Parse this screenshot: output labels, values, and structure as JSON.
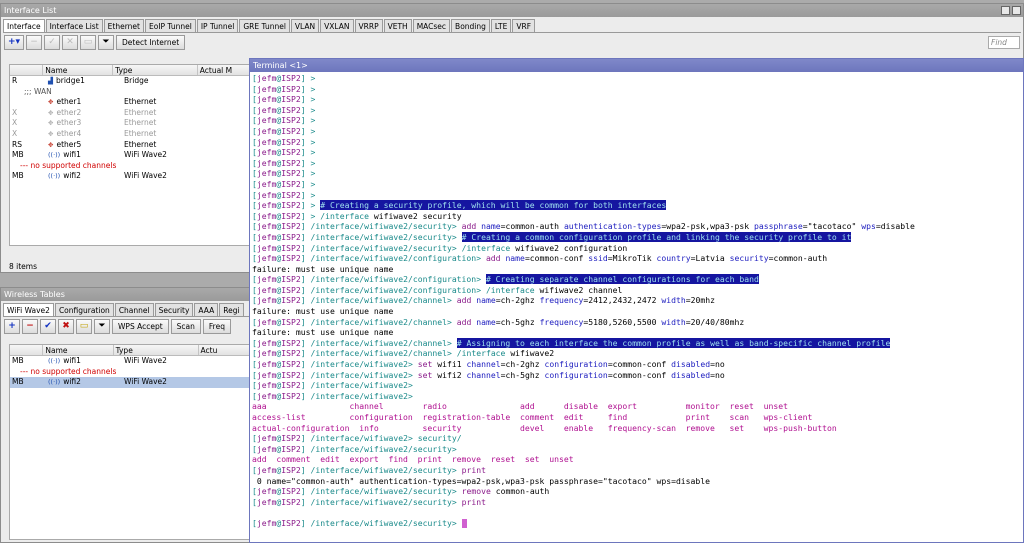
{
  "interface_window": {
    "title": "Interface List",
    "tabs": [
      "Interface",
      "Interface List",
      "Ethernet",
      "EoIP Tunnel",
      "IP Tunnel",
      "GRE Tunnel",
      "VLAN",
      "VXLAN",
      "VRRP",
      "VETH",
      "MACsec",
      "Bonding",
      "LTE",
      "VRF"
    ],
    "detect_button": "Detect Internet",
    "find_placeholder": "Find",
    "columns": [
      "",
      "Name",
      "Type",
      "Actual M"
    ],
    "rows": [
      {
        "flag": "R",
        "name": "bridge1",
        "type": "Bridge",
        "icon": "bridge-icon"
      },
      {
        "section": ";;; WAN"
      },
      {
        "flag": "",
        "name": "ether1",
        "type": "Ethernet",
        "icon": "ethernet-icon"
      },
      {
        "flag": "X",
        "name": "ether2",
        "type": "Ethernet",
        "icon": "ethernet-icon",
        "disabled": true
      },
      {
        "flag": "X",
        "name": "ether3",
        "type": "Ethernet",
        "icon": "ethernet-icon",
        "disabled": true
      },
      {
        "flag": "X",
        "name": "ether4",
        "type": "Ethernet",
        "icon": "ethernet-icon",
        "disabled": true
      },
      {
        "flag": "RS",
        "name": "ether5",
        "type": "Ethernet",
        "icon": "ethernet-icon"
      },
      {
        "flag": "MB",
        "name": "wifi1",
        "type": "WiFi Wave2",
        "icon": "wifi-icon"
      },
      {
        "comment": "--- no supported channels"
      },
      {
        "flag": "MB",
        "name": "wifi2",
        "type": "WiFi Wave2",
        "icon": "wifi-icon"
      }
    ],
    "status": "8 items"
  },
  "wireless_window": {
    "title": "Wireless Tables",
    "tabs": [
      "WiFi Wave2",
      "Configuration",
      "Channel",
      "Security",
      "AAA",
      "Regi"
    ],
    "wps_button": "WPS Accept",
    "scan_button": "Scan",
    "freq_button": "Freq",
    "columns": [
      "",
      "Name",
      "Type",
      "Actu"
    ],
    "rows": [
      {
        "flag": "MB",
        "name": "wifi1",
        "type": "WiFi Wave2"
      },
      {
        "comment": "--- no supported channels"
      },
      {
        "flag": "MB",
        "name": "wifi2",
        "type": "WiFi Wave2",
        "selected": true
      }
    ]
  },
  "terminal": {
    "title": "Terminal <1>",
    "user": "jefm",
    "host": "ISP2",
    "lines": [
      {
        "path": "",
        "cmd": ""
      },
      {
        "path": "",
        "cmd": ""
      },
      {
        "path": "",
        "cmd": ""
      },
      {
        "path": "",
        "cmd": ""
      },
      {
        "path": "",
        "cmd": ""
      },
      {
        "path": "",
        "cmd": ""
      },
      {
        "path": "",
        "cmd": ""
      },
      {
        "path": "",
        "cmd": ""
      },
      {
        "path": "",
        "cmd": ""
      },
      {
        "path": "",
        "cmd": ""
      },
      {
        "path": "",
        "cmd": ""
      },
      {
        "path": "",
        "cmd": ""
      },
      {
        "path": "",
        "comment": "# Creating a security profile, which will be common for both interfaces"
      },
      {
        "path": "",
        "cmd": "/interface wifiwave2 security"
      },
      {
        "path": "/interface/wifiwave2/security",
        "cmd": "add name=common-auth authentication-types=wpa2-psk,wpa3-psk passphrase=\"tacotaco\" wps=disable"
      },
      {
        "path": "/interface/wifiwave2/security",
        "comment": "# Creating a common configuration profile and linking the security profile to it"
      },
      {
        "path": "/interface/wifiwave2/security",
        "cmd": "/interface wifiwave2 configuration"
      },
      {
        "path": "/interface/wifiwave2/configuration",
        "cmd": "add name=common-conf ssid=MikroTik country=Latvia security=common-auth"
      },
      {
        "output": "failure: must use unique name"
      },
      {
        "path": "/interface/wifiwave2/configuration",
        "comment": "# Creating separate channel configurations for each band"
      },
      {
        "path": "/interface/wifiwave2/configuration",
        "cmd": "/interface wifiwave2 channel"
      },
      {
        "path": "/interface/wifiwave2/channel",
        "cmd": "add name=ch-2ghz frequency=2412,2432,2472 width=20mhz"
      },
      {
        "output": "failure: must use unique name"
      },
      {
        "path": "/interface/wifiwave2/channel",
        "cmd": "add name=ch-5ghz frequency=5180,5260,5500 width=20/40/80mhz"
      },
      {
        "output": "failure: must use unique name"
      },
      {
        "path": "/interface/wifiwave2/channel",
        "comment": "# Assigning to each interface the common profile as well as band-specific channel profile"
      },
      {
        "path": "/interface/wifiwave2/channel",
        "cmd": "/interface wifiwave2"
      },
      {
        "path": "/interface/wifiwave2",
        "cmd": "set wifi1 channel=ch-2ghz configuration=common-conf disabled=no"
      },
      {
        "path": "/interface/wifiwave2",
        "cmd": "set wifi2 channel=ch-5ghz configuration=common-conf disabled=no"
      },
      {
        "path": "/interface/wifiwave2",
        "cmd": ""
      },
      {
        "path": "/interface/wifiwave2",
        "cmd": ""
      },
      {
        "completion": "aaa                 channel        radio               add      disable  export          monitor  reset  unset"
      },
      {
        "completion": "access-list         configuration  registration-table  comment  edit     find            print    scan   wps-client"
      },
      {
        "completion": "actual-configuration  info         security            devel    enable   frequency-scan  remove   set    wps-push-button"
      },
      {
        "path": "/interface/wifiwave2",
        "cmd": "security/"
      },
      {
        "path": "/interface/wifiwave2/security",
        "cmd": ""
      },
      {
        "completion": "add  comment  edit  export  find  print  remove  reset  set  unset"
      },
      {
        "path": "/interface/wifiwave2/security",
        "cmd": "print"
      },
      {
        "output": " 0 name=\"common-auth\" authentication-types=wpa2-psk,wpa3-psk passphrase=\"tacotaco\" wps=disable"
      },
      {
        "path": "/interface/wifiwave2/security",
        "cmd": "remove common-auth"
      },
      {
        "path": "/interface/wifiwave2/security",
        "cmd": "print"
      },
      {
        "output": ""
      },
      {
        "path": "/interface/wifiwave2/security",
        "cmd": "",
        "cursor": true
      }
    ]
  }
}
